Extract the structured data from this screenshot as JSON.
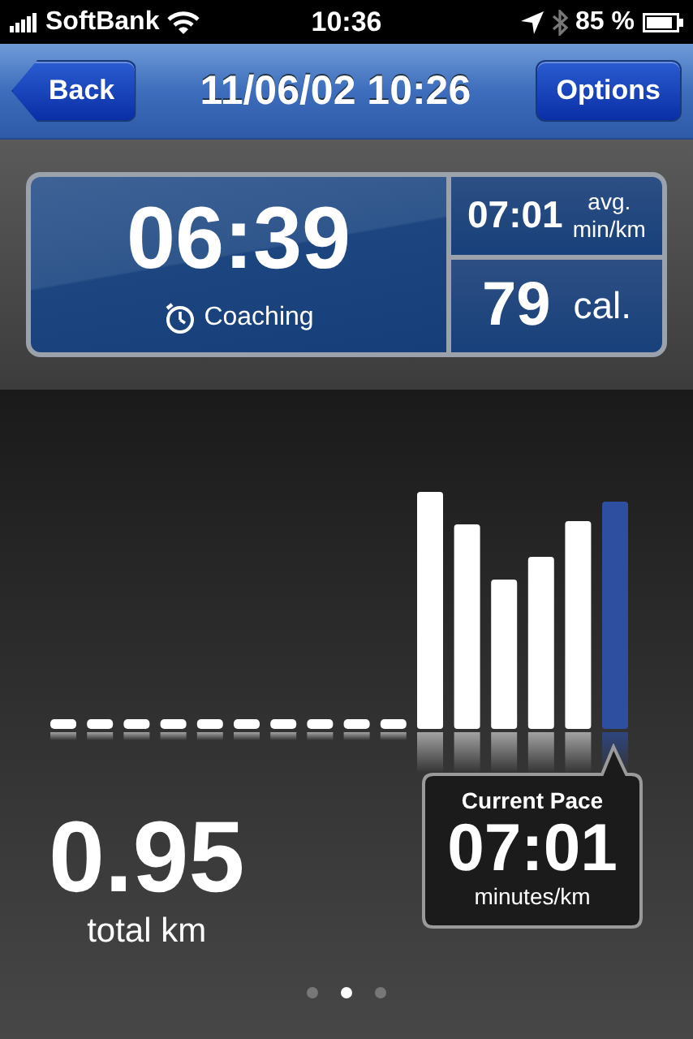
{
  "status_bar": {
    "carrier": "SoftBank",
    "time": "10:36",
    "battery": "85 %"
  },
  "nav_bar": {
    "back": "Back",
    "title": "11/06/02 10:26",
    "options": "Options"
  },
  "summary": {
    "duration": "06:39",
    "mode": "Coaching",
    "avg_pace": "07:01",
    "avg_label": "avg.",
    "avg_unit": "min/km",
    "calories": "79",
    "calories_unit": "cal."
  },
  "distance": {
    "value": "0.95",
    "label": "total km"
  },
  "current_pace": {
    "title": "Current Pace",
    "value": "07:01",
    "unit": "minutes/km"
  },
  "pages": [
    {
      "selected": false
    },
    {
      "selected": true
    },
    {
      "selected": false
    }
  ]
}
